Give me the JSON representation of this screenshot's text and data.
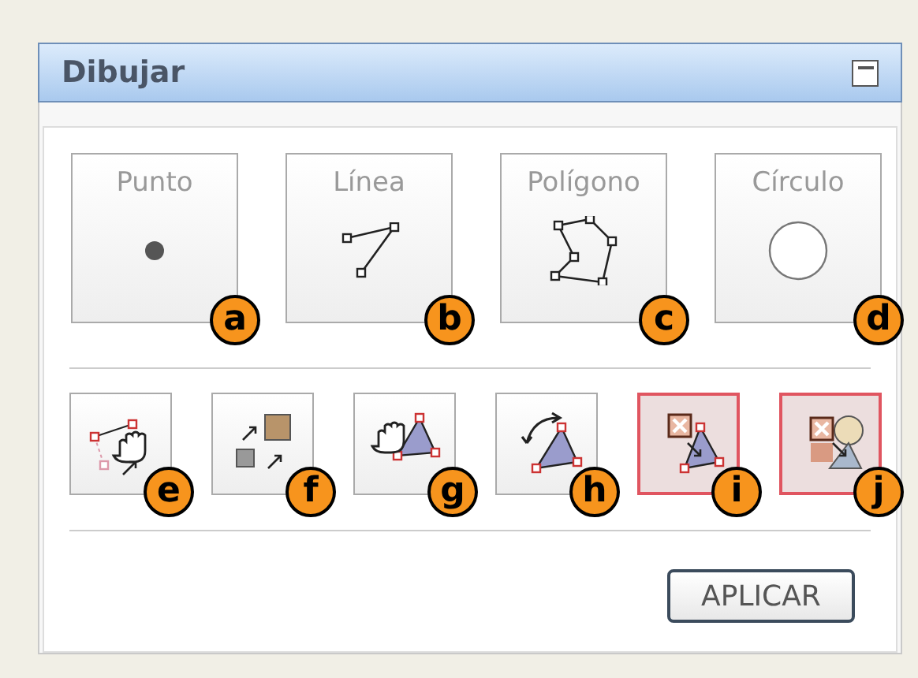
{
  "panel": {
    "title": "Dibujar"
  },
  "shapes": [
    {
      "label": "Punto",
      "kind": "point",
      "badge": "a"
    },
    {
      "label": "Línea",
      "kind": "line",
      "badge": "b"
    },
    {
      "label": "Polígono",
      "kind": "polygon",
      "badge": "c"
    },
    {
      "label": "Círculo",
      "kind": "circle",
      "badge": "d"
    }
  ],
  "tools": [
    {
      "kind": "reshape",
      "badge": "e"
    },
    {
      "kind": "resize",
      "badge": "f"
    },
    {
      "kind": "move",
      "badge": "g"
    },
    {
      "kind": "rotate",
      "badge": "h"
    },
    {
      "kind": "delete",
      "badge": "i"
    },
    {
      "kind": "delete-all",
      "badge": "j"
    }
  ],
  "apply_button": "APLICAR"
}
